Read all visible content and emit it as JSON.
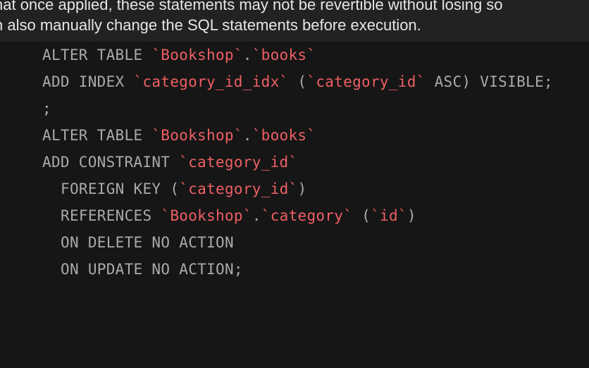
{
  "notice": {
    "line1": "hat once applied, these statements may not be revertible without losing so",
    "line2": "n also manually change the SQL statements before execution."
  },
  "sql_lines": [
    {
      "indent": false,
      "tokens": [
        {
          "t": "kw",
          "v": "ALTER TABLE "
        },
        {
          "t": "id",
          "v": "`Bookshop`"
        },
        {
          "t": "p",
          "v": "."
        },
        {
          "t": "id",
          "v": "`books`"
        }
      ]
    },
    {
      "indent": false,
      "tokens": [
        {
          "t": "kw",
          "v": "ADD INDEX "
        },
        {
          "t": "id",
          "v": "`category_id_idx`"
        },
        {
          "t": "p",
          "v": " ("
        },
        {
          "t": "id",
          "v": "`category_id`"
        },
        {
          "t": "kw",
          "v": " ASC) VISIBLE;"
        }
      ]
    },
    {
      "indent": false,
      "tokens": [
        {
          "t": "p",
          "v": ";"
        }
      ]
    },
    {
      "indent": false,
      "tokens": [
        {
          "t": "kw",
          "v": "ALTER TABLE "
        },
        {
          "t": "id",
          "v": "`Bookshop`"
        },
        {
          "t": "p",
          "v": "."
        },
        {
          "t": "id",
          "v": "`books`"
        }
      ]
    },
    {
      "indent": false,
      "tokens": [
        {
          "t": "kw",
          "v": "ADD CONSTRAINT "
        },
        {
          "t": "id",
          "v": "`category_id`"
        }
      ]
    },
    {
      "indent": true,
      "tokens": [
        {
          "t": "kw",
          "v": "FOREIGN KEY ("
        },
        {
          "t": "id",
          "v": "`category_id`"
        },
        {
          "t": "p",
          "v": ")"
        }
      ]
    },
    {
      "indent": true,
      "tokens": [
        {
          "t": "kw",
          "v": "REFERENCES "
        },
        {
          "t": "id",
          "v": "`Bookshop`"
        },
        {
          "t": "p",
          "v": "."
        },
        {
          "t": "id",
          "v": "`category`"
        },
        {
          "t": "p",
          "v": " ("
        },
        {
          "t": "id",
          "v": "`id`"
        },
        {
          "t": "p",
          "v": ")"
        }
      ]
    },
    {
      "indent": true,
      "tokens": [
        {
          "t": "kw",
          "v": "ON DELETE NO ACTION"
        }
      ]
    },
    {
      "indent": true,
      "tokens": [
        {
          "t": "kw",
          "v": "ON UPDATE NO ACTION;"
        }
      ]
    }
  ]
}
